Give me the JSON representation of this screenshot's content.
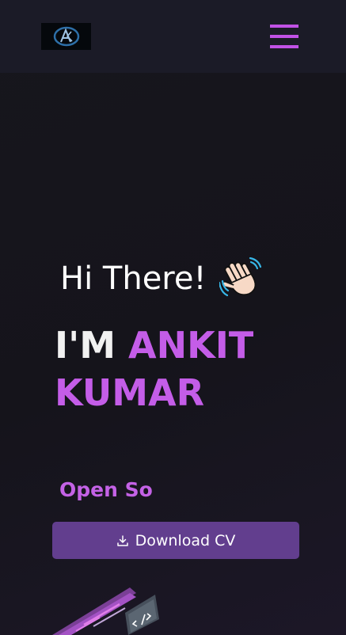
{
  "navbar": {
    "logo_icon": "ak-monogram-logo",
    "menu_icon": "hamburger-menu-icon"
  },
  "hero": {
    "greeting": "Hi There!",
    "greeting_icon": "waving-hand-emoji",
    "name_prefix": "I'M",
    "name_first": "ANKIT",
    "name_last": "KUMAR",
    "typewriter_text": "Open So",
    "download_label": "Download CV",
    "download_icon": "download-icon",
    "illustration_icon": "code-laptop-illustration"
  },
  "colors": {
    "background": "#16151c",
    "navbar": "#1b1b27",
    "accent": "#c45de8",
    "button": "#623e8e",
    "text": "#ffffff"
  }
}
